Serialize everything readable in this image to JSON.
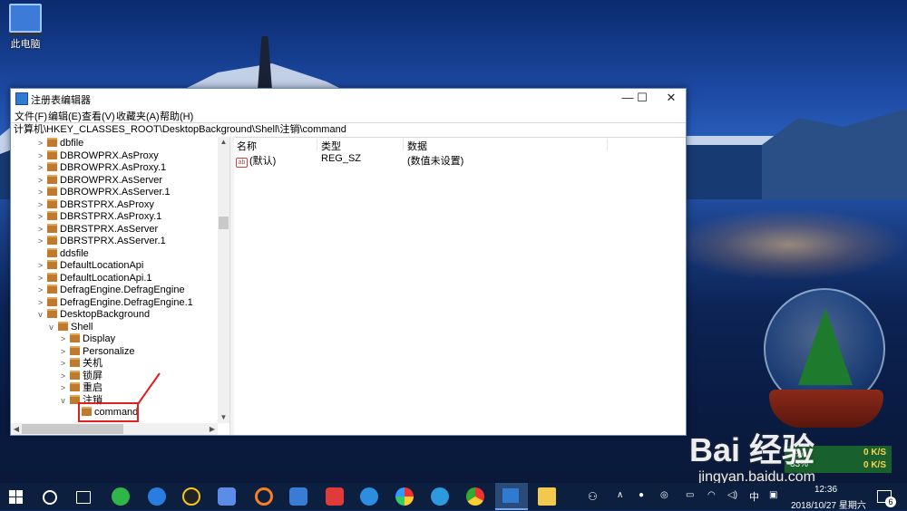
{
  "desktop": {
    "icon_label": "此电脑",
    "watermark": "Bai 经验",
    "watermark_sub": "jingyan.baidu.com",
    "net_monitor": {
      "percent": "7%",
      "percent2": "33%",
      "up": "0 K/S",
      "down": "0 K/S"
    }
  },
  "window": {
    "title": "注册表编辑器",
    "menu": [
      "文件(F)",
      "编辑(E)",
      "查看(V)",
      "收藏夹(A)",
      "帮助(H)"
    ],
    "address": "计算机\\HKEY_CLASSES_ROOT\\DesktopBackground\\Shell\\注销\\command",
    "controls": {
      "minimize": "—",
      "maximize": "☐",
      "close": "✕"
    }
  },
  "tree": {
    "items": [
      {
        "label": "dbfile",
        "expander": ">"
      },
      {
        "label": "DBROWPRX.AsProxy",
        "expander": ">"
      },
      {
        "label": "DBROWPRX.AsProxy.1",
        "expander": ">"
      },
      {
        "label": "DBROWPRX.AsServer",
        "expander": ">"
      },
      {
        "label": "DBROWPRX.AsServer.1",
        "expander": ">"
      },
      {
        "label": "DBRSTPRX.AsProxy",
        "expander": ">"
      },
      {
        "label": "DBRSTPRX.AsProxy.1",
        "expander": ">"
      },
      {
        "label": "DBRSTPRX.AsServer",
        "expander": ">"
      },
      {
        "label": "DBRSTPRX.AsServer.1",
        "expander": ">"
      },
      {
        "label": "ddsfile",
        "expander": ""
      },
      {
        "label": "DefaultLocationApi",
        "expander": ">"
      },
      {
        "label": "DefaultLocationApi.1",
        "expander": ">"
      },
      {
        "label": "DefragEngine.DefragEngine",
        "expander": ">"
      },
      {
        "label": "DefragEngine.DefragEngine.1",
        "expander": ">"
      },
      {
        "label": "DesktopBackground",
        "expander": "v"
      },
      {
        "label": "Shell",
        "expander": "v"
      },
      {
        "label": "Display",
        "expander": ">"
      },
      {
        "label": "Personalize",
        "expander": ">"
      },
      {
        "label": "关机",
        "expander": ">"
      },
      {
        "label": "锁屏",
        "expander": ">"
      },
      {
        "label": "重启",
        "expander": ">"
      },
      {
        "label": "注销",
        "expander": "v"
      },
      {
        "label": "command",
        "expander": ""
      }
    ]
  },
  "list": {
    "columns": [
      "名称",
      "类型",
      "数据"
    ],
    "rows": [
      {
        "name": "(默认)",
        "type": "REG_SZ",
        "data": "(数值未设置)"
      }
    ]
  },
  "taskbar": {
    "ime": "中",
    "time": "12:36",
    "date": "2018/10/27 星期六",
    "notification_count": "6"
  },
  "colors": {
    "highlight": "#e02020",
    "taskbar": "#0c1f3f"
  }
}
